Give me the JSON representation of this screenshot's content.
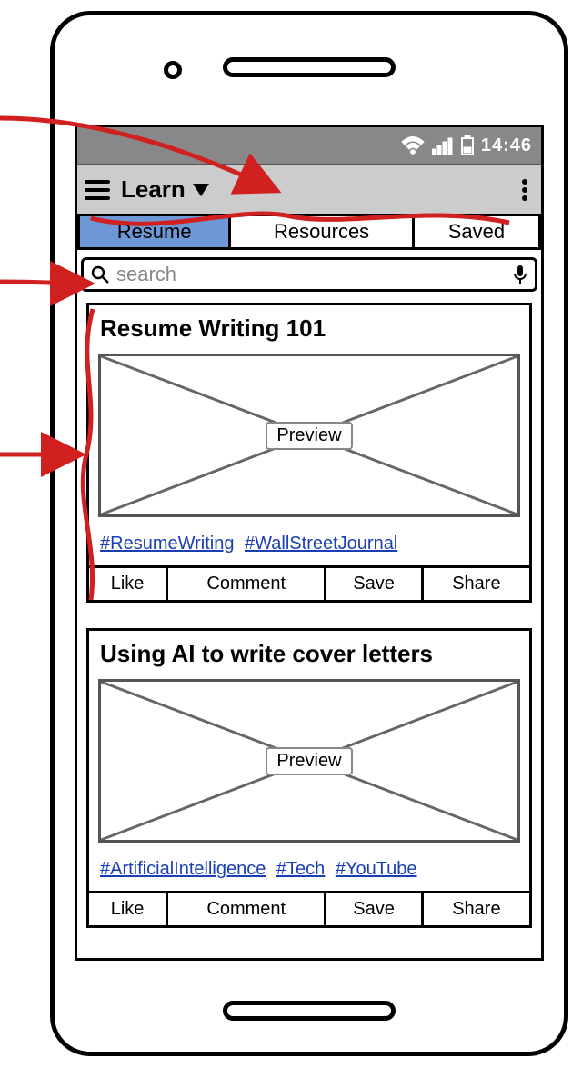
{
  "status": {
    "time": "14:46"
  },
  "appbar": {
    "title": "Learn"
  },
  "tabs": [
    {
      "label": "Resume",
      "active": true
    },
    {
      "label": "Resources",
      "active": false
    },
    {
      "label": "Saved",
      "active": false
    }
  ],
  "search": {
    "placeholder": "search"
  },
  "cards": [
    {
      "title": "Resume Writing 101",
      "preview_label": "Preview",
      "hashtags": [
        "#ResumeWriting",
        "#WallStreetJournal"
      ],
      "actions": [
        "Like",
        "Comment",
        "Save",
        "Share"
      ]
    },
    {
      "title": "Using AI to write cover letters",
      "preview_label": "Preview",
      "hashtags": [
        "#ArtificialIntelligence",
        "#Tech",
        "#YouTube"
      ],
      "actions": [
        "Like",
        "Comment",
        "Save",
        "Share"
      ]
    }
  ]
}
